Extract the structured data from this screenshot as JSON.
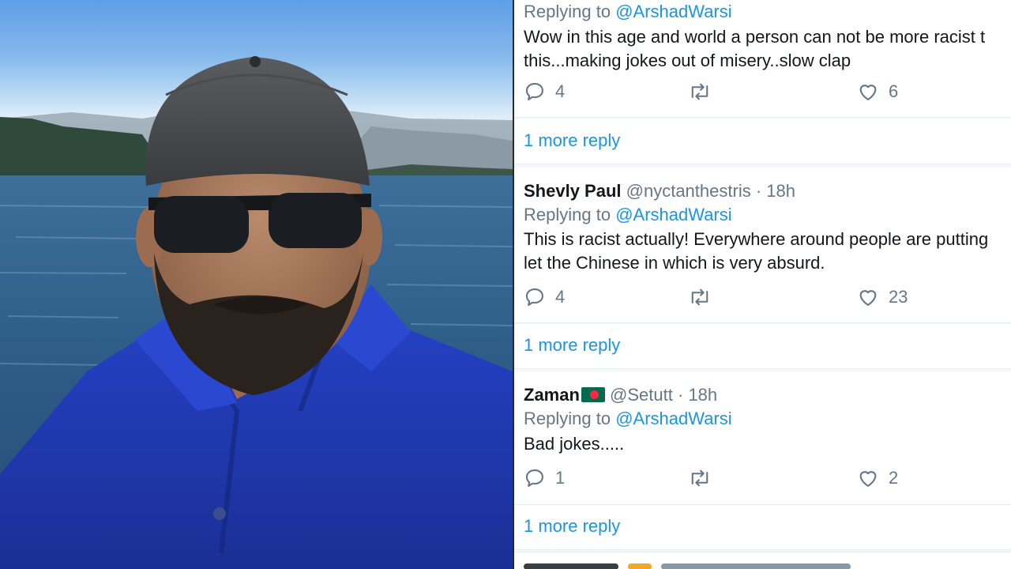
{
  "feed": {
    "tweets": [
      {
        "name": "",
        "handle": "",
        "time": "",
        "replying_label": "Replying to",
        "replying_to": "@ArshadWarsi",
        "lines": [
          "Wow in this age and world a person can not be more racist t",
          "this...making jokes out of misery..slow clap"
        ],
        "replies": "4",
        "retweets": "",
        "likes": "6",
        "more_replies": "1 more reply"
      },
      {
        "name": "Shevly Paul",
        "handle": "@nyctanthestris",
        "time": "· 18h",
        "replying_label": "Replying to",
        "replying_to": "@ArshadWarsi",
        "lines": [
          "This is racist actually! Everywhere around people are putting",
          "let the Chinese in which is very absurd."
        ],
        "replies": "4",
        "retweets": "",
        "likes": "23",
        "more_replies": "1 more reply"
      },
      {
        "name": "Zaman",
        "handle": "@Setutt",
        "time": "· 18h",
        "replying_label": "Replying to",
        "replying_to": "@ArshadWarsi",
        "lines": [
          "Bad jokes....."
        ],
        "replies": "1",
        "retweets": "",
        "likes": "2",
        "more_replies": "1 more reply"
      }
    ]
  },
  "icons": [
    "reply-icon",
    "retweet-icon",
    "like-icon",
    "bangladesh-flag-icon"
  ],
  "colors": {
    "link": "#1b95e0",
    "text": "#14171a",
    "muted": "#657786",
    "shirt": "#1f3fb8"
  }
}
